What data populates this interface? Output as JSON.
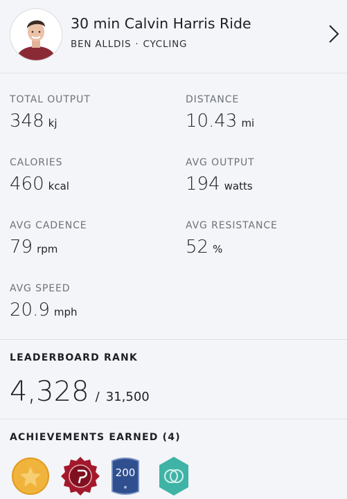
{
  "header": {
    "class_title": "30 min Calvin Harris Ride",
    "instructor": "BEN ALLDIS",
    "separator": "·",
    "discipline": "CYCLING",
    "chevron_icon": "chevron-right-icon"
  },
  "metrics": [
    {
      "label": "TOTAL OUTPUT",
      "value": "348",
      "unit": "kj"
    },
    {
      "label": "DISTANCE",
      "value": "10.43",
      "unit": "mi"
    },
    {
      "label": "CALORIES",
      "value": "460",
      "unit": "kcal"
    },
    {
      "label": "AVG OUTPUT",
      "value": "194",
      "unit": "watts"
    },
    {
      "label": "AVG CADENCE",
      "value": "79",
      "unit": "rpm"
    },
    {
      "label": "AVG RESISTANCE",
      "value": "52",
      "unit": "%"
    },
    {
      "label": "AVG SPEED",
      "value": "20.9",
      "unit": "mph"
    }
  ],
  "leaderboard": {
    "title": "LEADERBOARD RANK",
    "rank": "4,328",
    "separator": "/",
    "total": "31,500"
  },
  "achievements": {
    "title": "ACHIEVEMENTS EARNED (4)",
    "badges": [
      {
        "icon": "gold-star-badge-icon",
        "color": "#f0b43c"
      },
      {
        "icon": "peloton-red-badge-icon",
        "color": "#a3192b"
      },
      {
        "icon": "200-rides-badge-icon",
        "color": "#2f4f8f",
        "text": "200"
      },
      {
        "icon": "teal-circles-badge-icon",
        "color": "#3fb3a5"
      }
    ]
  }
}
